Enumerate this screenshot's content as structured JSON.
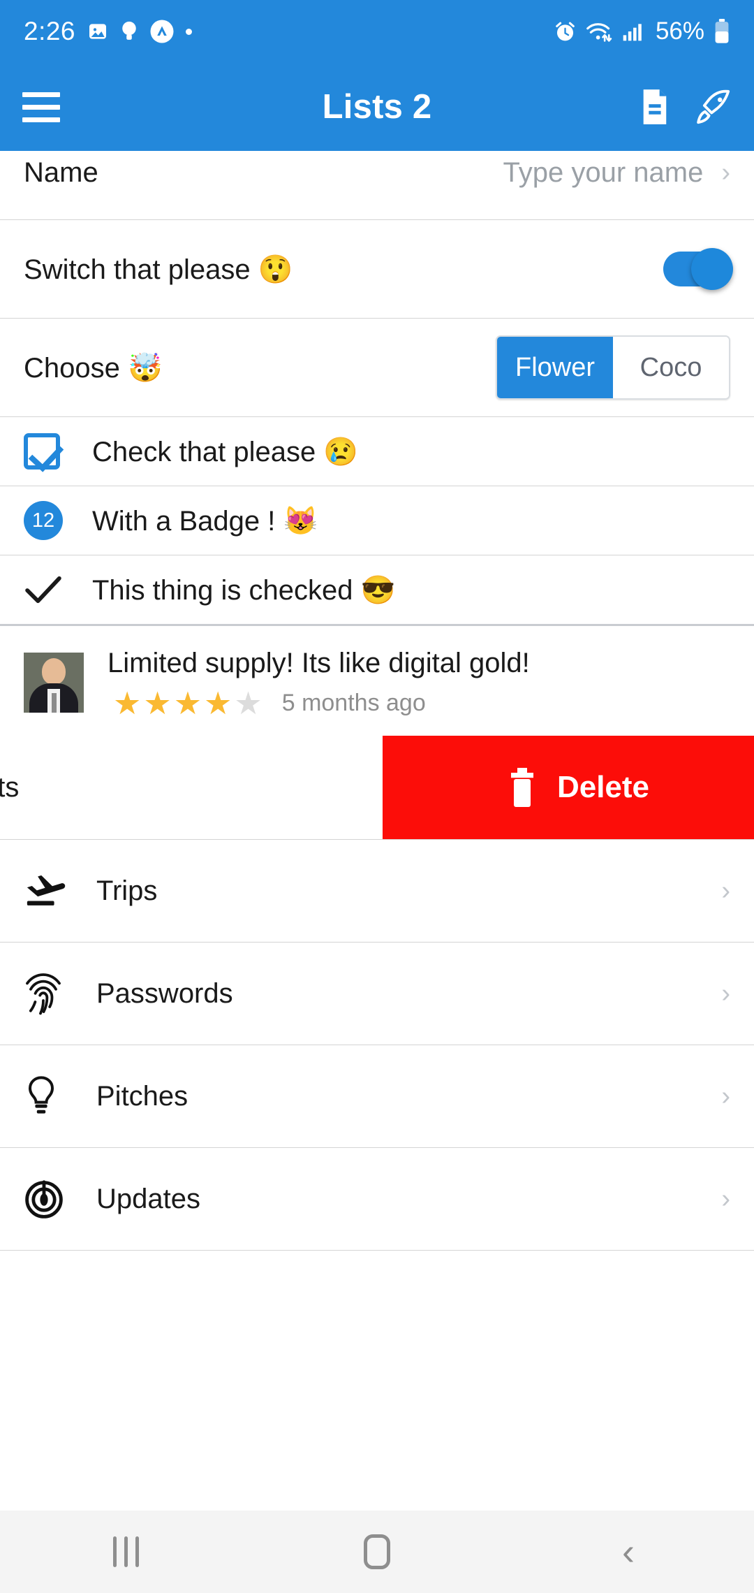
{
  "status_bar": {
    "time": "2:26",
    "battery_percent": "56%",
    "left_icons": [
      "image-icon",
      "bulb-icon",
      "app-circle-icon",
      "dot-icon"
    ],
    "right_icons": [
      "alarm-icon",
      "wifi-icon",
      "signal-icon",
      "battery-icon"
    ]
  },
  "app_bar": {
    "title": "Lists 2",
    "menu_icon": "hamburger-icon",
    "actions": [
      "document-icon",
      "rocket-icon"
    ]
  },
  "rows": {
    "name": {
      "label": "Name",
      "placeholder": "Type your name",
      "value": ""
    },
    "switch": {
      "label": "Switch that please 😲",
      "on": true
    },
    "choose": {
      "label": "Choose 🤯",
      "options": [
        "Flower",
        "Coco"
      ],
      "selected": "Flower"
    },
    "check": {
      "label": "Check that please 😢",
      "checked": true
    },
    "badge": {
      "label": "With a Badge ! 😻",
      "count": "12"
    },
    "checked_thing": {
      "label": "This thing is checked 😎",
      "mark": "✓"
    }
  },
  "review": {
    "title": "Limited supply! Its like digital gold!",
    "rating": 4,
    "max_rating": 5,
    "time_ago": "5 months ago",
    "star_filled": "★",
    "star_empty": "★"
  },
  "swipe_row": {
    "visible_text": "nts",
    "delete_label": "Delete",
    "delete_icon": "trash-icon",
    "delete_color": "#FC0D09"
  },
  "menu_items": [
    {
      "label": "Trips",
      "icon": "airplane-landing-icon"
    },
    {
      "label": "Passwords",
      "icon": "fingerprint-icon"
    },
    {
      "label": "Pitches",
      "icon": "lightbulb-icon"
    },
    {
      "label": "Updates",
      "icon": "target-radar-icon"
    }
  ],
  "nav_bar": {
    "recents": "recents-icon",
    "home": "home-icon",
    "back": "back-icon"
  },
  "colors": {
    "accent": "#2388DB",
    "delete": "#FC0D09",
    "star": "#FAB932",
    "muted": "#9aa0a6"
  },
  "chevron": "›"
}
